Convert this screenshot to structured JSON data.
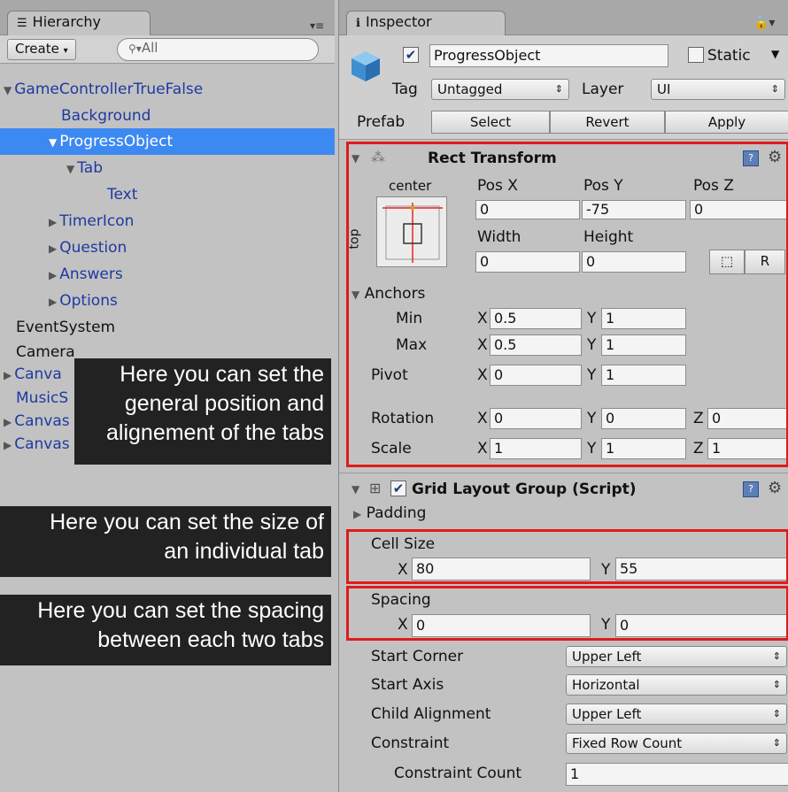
{
  "hierarchy": {
    "tab_label": "Hierarchy",
    "create_label": "Create",
    "search_placeholder": "All",
    "items": [
      {
        "label": "GameControllerTrueFalse",
        "arrow": "▼"
      },
      {
        "label": "Background",
        "arrow": ""
      },
      {
        "label": "ProgressObject",
        "arrow": "▼"
      },
      {
        "label": "Tab",
        "arrow": "▼"
      },
      {
        "label": "Text",
        "arrow": ""
      },
      {
        "label": "TimerIcon",
        "arrow": "▶"
      },
      {
        "label": "Question",
        "arrow": "▶"
      },
      {
        "label": "Answers",
        "arrow": "▶"
      },
      {
        "label": "Options",
        "arrow": "▶"
      },
      {
        "label": "EventSystem",
        "arrow": ""
      },
      {
        "label": "Camera",
        "arrow": ""
      },
      {
        "label": "Canva",
        "arrow": "▶"
      },
      {
        "label": "MusicS",
        "arrow": ""
      },
      {
        "label": "Canvas LargerImage",
        "arrow": "▶"
      },
      {
        "label": "Canvas Options",
        "arrow": "▶"
      }
    ]
  },
  "callouts": {
    "position": [
      "Here you can set the",
      "general position and",
      "alignement of the tabs"
    ],
    "size": [
      "Here you can set the size of",
      "an individual tab"
    ],
    "spacing": [
      "Here you can set the spacing",
      "between each two tabs"
    ]
  },
  "inspector": {
    "tab_label": "Inspector",
    "object_name": "ProgressObject",
    "static_label": "Static",
    "tag_label": "Tag",
    "tag_value": "Untagged",
    "layer_label": "Layer",
    "layer_value": "UI",
    "prefab_label": "Prefab",
    "prefab_buttons": [
      "Select",
      "Revert",
      "Apply"
    ],
    "rect_transform": {
      "title": "Rect Transform",
      "anchor_preset_h": "center",
      "anchor_preset_v": "top",
      "pos_x_label": "Pos X",
      "pos_y_label": "Pos Y",
      "pos_z_label": "Pos Z",
      "pos_x": "0",
      "pos_y": "-75",
      "pos_z": "0",
      "width_label": "Width",
      "height_label": "Height",
      "width": "0",
      "height": "0",
      "r_button": "R",
      "anchors_label": "Anchors",
      "min_label": "Min",
      "max_label": "Max",
      "pivot_label": "Pivot",
      "rotation_label": "Rotation",
      "scale_label": "Scale",
      "min_x": "0.5",
      "min_y": "1",
      "max_x": "0.5",
      "max_y": "1",
      "pivot_x": "0",
      "pivot_y": "1",
      "rot_x": "0",
      "rot_y": "0",
      "rot_z": "0",
      "scale_x": "1",
      "scale_y": "1",
      "scale_z": "1",
      "x": "X",
      "y": "Y",
      "z": "Z"
    },
    "grid_layout": {
      "title": "Grid Layout Group (Script)",
      "padding_label": "Padding",
      "cell_size_label": "Cell Size",
      "cell_x": "80",
      "cell_y": "55",
      "spacing_label": "Spacing",
      "spacing_x": "0",
      "spacing_y": "0",
      "start_corner_label": "Start Corner",
      "start_corner": "Upper Left",
      "start_axis_label": "Start Axis",
      "start_axis": "Horizontal",
      "child_alignment_label": "Child Alignment",
      "child_alignment": "Upper Left",
      "constraint_label": "Constraint",
      "constraint": "Fixed Row Count",
      "constraint_count_label": "Constraint Count",
      "constraint_count": "1"
    }
  },
  "colors": {
    "selection": "#3d89f2",
    "highlight_box": "#e01b1b",
    "callout_bg": "#222222"
  }
}
